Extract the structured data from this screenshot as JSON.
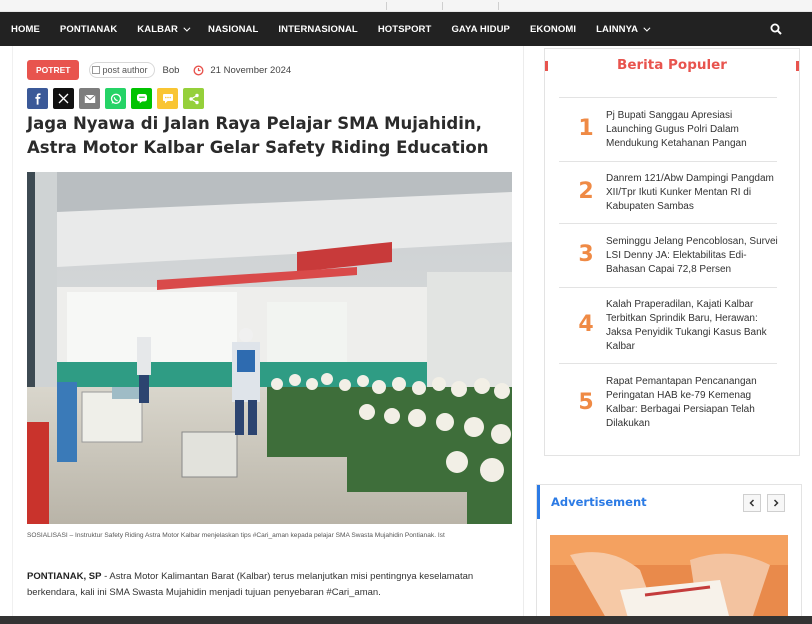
{
  "nav": {
    "items": [
      {
        "label": "HOME",
        "dropdown": false
      },
      {
        "label": "PONTIANAK",
        "dropdown": false
      },
      {
        "label": "KALBAR",
        "dropdown": true
      },
      {
        "label": "NASIONAL",
        "dropdown": false
      },
      {
        "label": "INTERNASIONAL",
        "dropdown": false
      },
      {
        "label": "HOTSPORT",
        "dropdown": false
      },
      {
        "label": "GAYA HIDUP",
        "dropdown": false
      },
      {
        "label": "EKONOMI",
        "dropdown": false
      },
      {
        "label": "LAINNYA",
        "dropdown": true
      }
    ],
    "search_icon": "search-icon"
  },
  "article": {
    "category": "POTRET",
    "author_img_alt": "post author",
    "author": "Bob",
    "date": "21 November 2024",
    "share_buttons": [
      {
        "name": "facebook",
        "icon": "facebook-icon",
        "color": "#3b5998"
      },
      {
        "name": "x",
        "icon": "x-icon",
        "color": "#111111"
      },
      {
        "name": "email",
        "icon": "email-icon",
        "color": "#7d7d7d"
      },
      {
        "name": "whatsapp",
        "icon": "whatsapp-icon",
        "color": "#25d366"
      },
      {
        "name": "line",
        "icon": "line-icon",
        "color": "#00c300"
      },
      {
        "name": "sms",
        "icon": "sms-icon",
        "color": "#f9c533"
      },
      {
        "name": "share",
        "icon": "share-icon",
        "color": "#95d03a"
      }
    ],
    "title": "Jaga Nyawa di Jalan Raya Pelajar SMA Mujahidin, Astra Motor Kalbar Gelar Safety Riding Education",
    "caption": "SOSIALISASI – Instruktur Safety Riding Astra Motor Kalbar menjelaskan tips #Cari_aman kepada pelajar SMA Swasta Mujahidin Pontianak. Ist",
    "dateline": "PONTIANAK, SP",
    "body": " - Astra Motor Kalimantan Barat (Kalbar) terus melanjutkan misi pentingnya keselamatan berkendara, kali ini SMA Swasta Mujahidin menjadi tujuan penyebaran #Cari_aman."
  },
  "popular": {
    "title": "Berita Populer",
    "items": [
      {
        "rank": "1",
        "title": "Pj Bupati Sanggau Apresiasi Launching Gugus Polri Dalam Mendukung Ketahanan Pangan"
      },
      {
        "rank": "2",
        "title": "Danrem 121/Abw Dampingi Pangdam XII/Tpr Ikuti Kunker Mentan RI di Kabupaten Sambas"
      },
      {
        "rank": "3",
        "title": "Seminggu Jelang Pencoblosan, Survei LSI Denny JA: Elektabilitas Edi-Bahasan Capai 72,8 Persen"
      },
      {
        "rank": "4",
        "title": "Kalah Praperadilan, Kajati Kalbar Terbitkan Sprindik Baru, Herawan: Jaksa Penyidik Tukangi Kasus Bank Kalbar"
      },
      {
        "rank": "5",
        "title": "Rapat Pemantapan Pencanangan Peringatan HAB ke-79 Kemenag Kalbar: Berbagai Persiapan Telah Dilakukan"
      }
    ]
  },
  "advertisement": {
    "title": "Advertisement",
    "prev_icon": "chevron-left-icon",
    "next_icon": "chevron-right-icon"
  },
  "colors": {
    "nav_bg": "#222222",
    "accent_red": "#e8544e",
    "rank_orange": "#ef8a45",
    "ad_blue": "#2c7be5"
  }
}
